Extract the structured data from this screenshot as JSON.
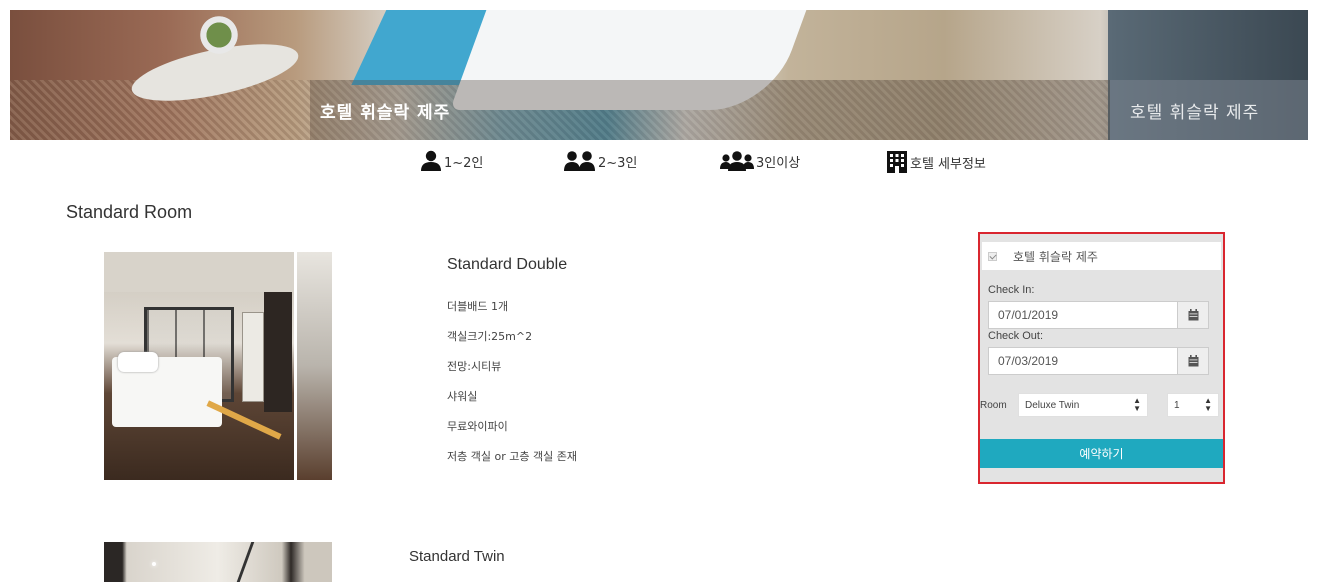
{
  "hero": {
    "title": "호텔 휘슬락 제주",
    "title_secondary": "호텔 휘슬락 제주"
  },
  "tabs": [
    {
      "label": "1~2인",
      "icon": "user-icon"
    },
    {
      "label": "2~3인",
      "icon": "users-icon"
    },
    {
      "label": "3인이상",
      "icon": "group-icon"
    },
    {
      "label": "호텔 세부정보",
      "icon": "building-icon"
    }
  ],
  "section": {
    "title": "Standard Room"
  },
  "rooms": [
    {
      "name": "Standard Double",
      "features": [
        "더블배드 1개",
        "객실크기:25m^2",
        "전망:시티뷰",
        "샤워실",
        "무료와이파이",
        "저층 객실 or 고층 객실 존재"
      ]
    },
    {
      "name": "Standard Twin"
    }
  ],
  "booking": {
    "hotel": "호텔 휘슬락 제주",
    "hotel_checked": true,
    "check_in_label": "Check In:",
    "check_in_value": "07/01/2019",
    "check_out_label": "Check Out:",
    "check_out_value": "07/03/2019",
    "room_label": "Room",
    "room_type": "Deluxe Twin",
    "room_count": "1",
    "submit_label": "예약하기",
    "accent_color": "#1fa9bf",
    "highlight_border_color": "#d9262f"
  }
}
